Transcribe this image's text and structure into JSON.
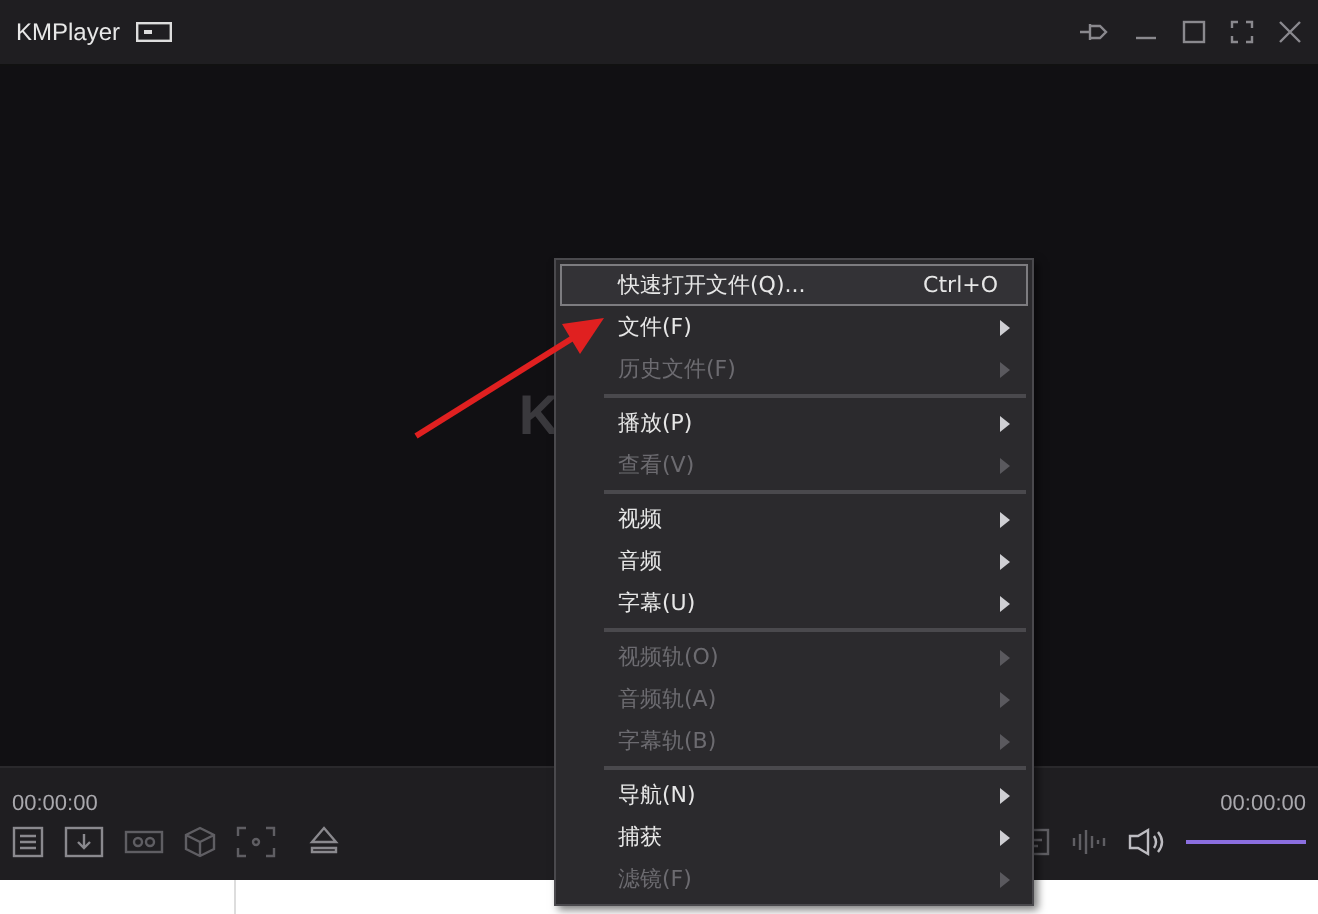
{
  "window": {
    "title": "KMPlayer"
  },
  "video": {
    "logo_letter": "K"
  },
  "controls": {
    "elapsed": "00:00:00",
    "total": "00:00:00",
    "volume": {
      "level": 1
    }
  },
  "context_menu": {
    "items": [
      {
        "kind": "item",
        "label": "快速打开文件(Q)...",
        "shortcut": "Ctrl+O",
        "submenu": false,
        "disabled": false,
        "selected": true
      },
      {
        "kind": "item",
        "label": "文件(F)",
        "submenu": true,
        "disabled": false,
        "selected": false
      },
      {
        "kind": "item",
        "label": "历史文件(F)",
        "submenu": true,
        "disabled": true,
        "selected": false
      },
      {
        "kind": "separator"
      },
      {
        "kind": "item",
        "label": "播放(P)",
        "submenu": true,
        "disabled": false,
        "selected": false
      },
      {
        "kind": "item",
        "label": "查看(V)",
        "submenu": true,
        "disabled": true,
        "selected": false
      },
      {
        "kind": "separator"
      },
      {
        "kind": "item",
        "label": "视频",
        "submenu": true,
        "disabled": false,
        "selected": false
      },
      {
        "kind": "item",
        "label": "音频",
        "submenu": true,
        "disabled": false,
        "selected": false
      },
      {
        "kind": "item",
        "label": "字幕(U)",
        "submenu": true,
        "disabled": false,
        "selected": false
      },
      {
        "kind": "separator"
      },
      {
        "kind": "item",
        "label": "视频轨(O)",
        "submenu": true,
        "disabled": true,
        "selected": false
      },
      {
        "kind": "item",
        "label": "音频轨(A)",
        "submenu": true,
        "disabled": true,
        "selected": false
      },
      {
        "kind": "item",
        "label": "字幕轨(B)",
        "submenu": true,
        "disabled": true,
        "selected": false
      },
      {
        "kind": "separator"
      },
      {
        "kind": "item",
        "label": "导航(N)",
        "submenu": true,
        "disabled": false,
        "selected": false
      },
      {
        "kind": "item",
        "label": "捕获",
        "submenu": true,
        "disabled": false,
        "selected": false
      },
      {
        "kind": "item",
        "label": "滤镜(F)",
        "submenu": true,
        "disabled": true,
        "selected": false
      }
    ]
  }
}
